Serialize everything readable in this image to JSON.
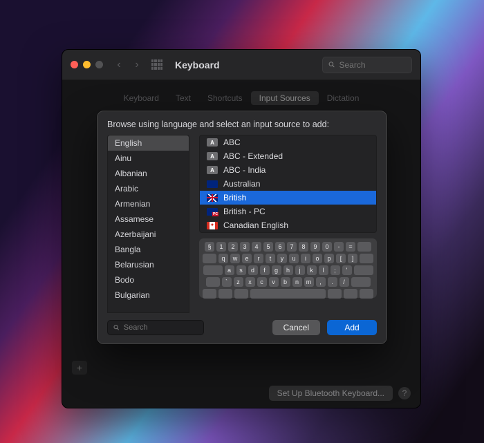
{
  "window": {
    "title": "Keyboard",
    "search_placeholder": "Search",
    "tabs": [
      "Keyboard",
      "Text",
      "Shortcuts",
      "Input Sources",
      "Dictation"
    ],
    "active_tab_index": 3,
    "bottom_button": "Set Up Bluetooth Keyboard...",
    "help_label": "?",
    "plus_label": "+"
  },
  "sheet": {
    "prompt": "Browse using language and select an input source to add:",
    "languages": [
      "English",
      "Ainu",
      "Albanian",
      "Arabic",
      "Armenian",
      "Assamese",
      "Azerbaijani",
      "Bangla",
      "Belarusian",
      "Bodo",
      "Bulgarian"
    ],
    "selected_language_index": 0,
    "sources": [
      {
        "label": "ABC",
        "flag": "abc"
      },
      {
        "label": "ABC - Extended",
        "flag": "abc"
      },
      {
        "label": "ABC - India",
        "flag": "abc"
      },
      {
        "label": "Australian",
        "flag": "au"
      },
      {
        "label": "British",
        "flag": "uk"
      },
      {
        "label": "British - PC",
        "flag": "ukpc"
      },
      {
        "label": "Canadian English",
        "flag": "ca"
      }
    ],
    "selected_source_index": 4,
    "search_placeholder": "Search",
    "cancel_label": "Cancel",
    "add_label": "Add",
    "keyboard_rows": [
      [
        "§",
        "1",
        "2",
        "3",
        "4",
        "5",
        "6",
        "7",
        "8",
        "9",
        "0",
        "-",
        "="
      ],
      [
        "q",
        "w",
        "e",
        "r",
        "t",
        "y",
        "u",
        "i",
        "o",
        "p",
        "[",
        "]"
      ],
      [
        "a",
        "s",
        "d",
        "f",
        "g",
        "h",
        "j",
        "k",
        "l",
        ";",
        "'"
      ],
      [
        "`",
        "z",
        "x",
        "c",
        "v",
        "b",
        "n",
        "m",
        ",",
        ".",
        "/"
      ]
    ]
  }
}
